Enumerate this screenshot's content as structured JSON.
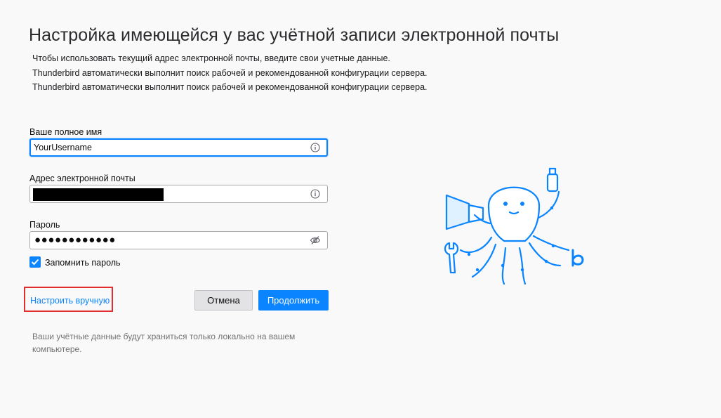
{
  "page": {
    "title": "Настройка имеющейся у вас учётной записи электронной почты",
    "description_lines": [
      "Чтобы использовать текущий адрес электронной почты, введите свои учетные данные.",
      "Thunderbird автоматически выполнит поиск рабочей и рекомендованной конфигурации сервера.",
      "Thunderbird автоматически выполнит поиск рабочей и рекомендованной конфигурации сервера."
    ]
  },
  "form": {
    "name_label": "Ваше полное имя",
    "name_value": "YourUsername",
    "email_label": "Адрес электронной почты",
    "password_label": "Пароль",
    "password_value": "●●●●●●●●●●●●",
    "remember_label": "Запомнить пароль",
    "remember_checked": true
  },
  "actions": {
    "manual_label": "Настроить вручную",
    "cancel_label": "Отмена",
    "continue_label": "Продолжить"
  },
  "footer": {
    "note": "Ваши учётные данные будут храниться только локально на вашем компьютере."
  },
  "colors": {
    "accent": "#0a84ff",
    "highlight": "#e22d2d",
    "mascot": "#0a84ff"
  },
  "icons": [
    "info-icon",
    "eye-slash-icon",
    "checkmark-icon",
    "octopus-mascot"
  ]
}
